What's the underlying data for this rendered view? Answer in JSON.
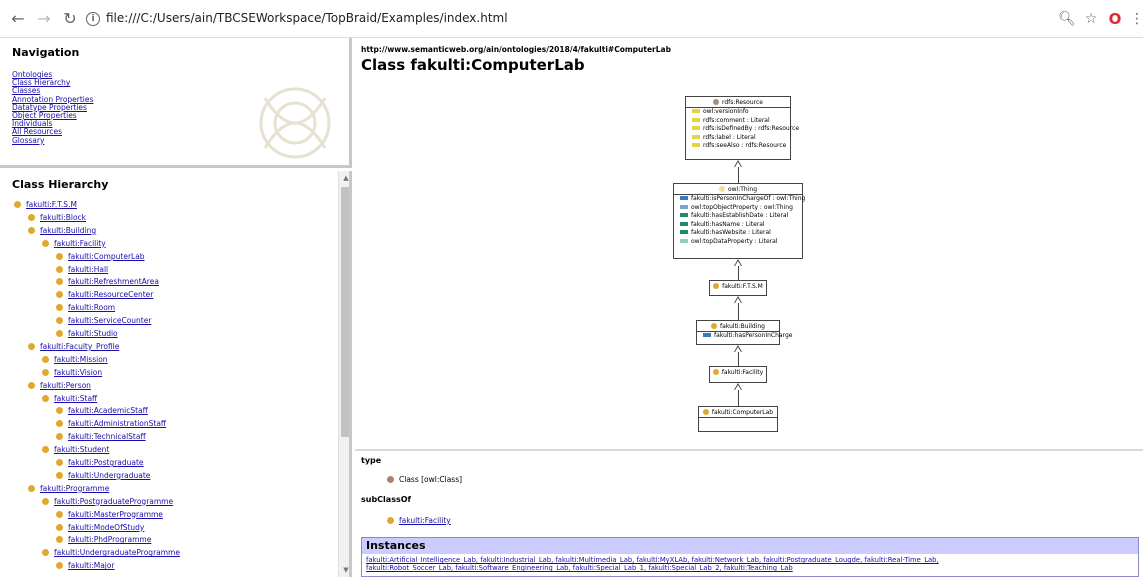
{
  "browser": {
    "url": "file:///C:/Users/ain/TBCSEWorkspace/TopBraid/Examples/index.html",
    "back_icon": "arrow-left",
    "forward_icon": "arrow-right",
    "reload_icon": "reload",
    "info_icon": "info",
    "zoom_icon": "magnifier",
    "bookmark_icon": "star",
    "opera_icon": "opera-logo",
    "menu_icon": "kebab-menu"
  },
  "navigation": {
    "heading": "Navigation",
    "links": [
      "Ontologies",
      "Class Hierarchy",
      "Classes",
      "Annotation Properties",
      "Datatype Properties",
      "Object Properties",
      "Individuals",
      "All Resources",
      "Glossary"
    ]
  },
  "class_hierarchy": {
    "heading": "Class Hierarchy",
    "items": [
      {
        "label": "fakulti:F.T.S.M",
        "depth": 0
      },
      {
        "label": "fakulti:Block",
        "depth": 1
      },
      {
        "label": "fakulti:Building",
        "depth": 1
      },
      {
        "label": "fakulti:Facility",
        "depth": 2
      },
      {
        "label": "fakulti:ComputerLab",
        "depth": 3
      },
      {
        "label": "fakulti:Hall",
        "depth": 3
      },
      {
        "label": "fakulti:RefreshmentArea",
        "depth": 3
      },
      {
        "label": "fakulti:ResourceCenter",
        "depth": 3
      },
      {
        "label": "fakulti:Room",
        "depth": 3
      },
      {
        "label": "fakulti:ServiceCounter",
        "depth": 3
      },
      {
        "label": "fakulti:Studio",
        "depth": 3
      },
      {
        "label": "fakulti:Faculty_Profile",
        "depth": 1
      },
      {
        "label": "fakulti:Mission",
        "depth": 2
      },
      {
        "label": "fakulti:Vision",
        "depth": 2
      },
      {
        "label": "fakulti:Person",
        "depth": 1
      },
      {
        "label": "fakulti:Staff",
        "depth": 2
      },
      {
        "label": "fakulti:AcademicStaff",
        "depth": 3
      },
      {
        "label": "fakulti:AdministrationStaff",
        "depth": 3
      },
      {
        "label": "fakulti:TechnicalStaff",
        "depth": 3
      },
      {
        "label": "fakulti:Student",
        "depth": 2
      },
      {
        "label": "fakulti:Postgraduate",
        "depth": 3
      },
      {
        "label": "fakulti:Undergraduate",
        "depth": 3
      },
      {
        "label": "fakulti:Programme",
        "depth": 1
      },
      {
        "label": "fakulti:PostgraduateProgramme",
        "depth": 2
      },
      {
        "label": "fakulti:MasterProgramme",
        "depth": 3
      },
      {
        "label": "fakulti:ModeOfStudy",
        "depth": 3
      },
      {
        "label": "fakulti:PhdProgramme",
        "depth": 3
      },
      {
        "label": "fakulti:UndergraduateProgramme",
        "depth": 2
      },
      {
        "label": "fakulti:Major",
        "depth": 3
      }
    ]
  },
  "main": {
    "uri": "http://www.semanticweb.org/ain/ontologies/2018/4/fakulti#ComputerLab",
    "title": "Class fakulti:ComputerLab",
    "diagram": {
      "rdfs_resource": {
        "title": "rdfs:Resource",
        "props": [
          "owl:versionInfo",
          "rdfs:comment : Literal",
          "rdfs:isDefinedBy : rdfs:Resource",
          "rdfs:label : Literal",
          "rdfs:seeAlso : rdfs:Resource"
        ]
      },
      "owl_thing": {
        "title": "owl:Thing",
        "props": [
          "fakulti:isPersonInChargeOf : owl:Thing",
          "owl:topObjectProperty : owl:Thing",
          "fakulti:hasEstablishDate : Literal",
          "fakulti:hasName : Literal",
          "fakulti:hasWebsite : Literal",
          "owl:topDataProperty : Literal"
        ],
        "prop_colors": [
          "#3a7bbf",
          "#6fa8dc",
          "#1f8a6b",
          "#1f8a6b",
          "#1f8a6b",
          "#8fd0b8"
        ]
      },
      "ftsm": {
        "title": "fakulti:F.T.S.M"
      },
      "building": {
        "title": "fakulti:Building",
        "props": [
          "fakulti:hasPersonInCharge"
        ]
      },
      "facility": {
        "title": "fakulti:Facility"
      },
      "computer_lab": {
        "title": "fakulti:ComputerLab"
      }
    },
    "type": {
      "label": "type",
      "value": "Class [owl:Class]"
    },
    "subclass_of": {
      "label": "subClassOf",
      "value": "fakulti:Facility"
    },
    "instances": {
      "heading": "Instances",
      "line1": "fakulti:Artificial_Intelligence_Lab, fakulti:Industrial_Lab, fakulti:Multimedia_Lab, fakulti:MyXLAb, fakulti:Network_Lab, fakulti:Postgraduate_Lougde, fakulti:Real-Time_Lab,",
      "line2": "fakulti:Robot_Soccer_Lab, fakulti:Software_Engineering_Lab, fakulti:Special_Lab_1, fakulti:Special_Lab_2, fakulti:Teaching_Lab"
    }
  },
  "colors": {
    "class_bullet": "#e0a82e",
    "type_bullet": "#b08070",
    "annotation_prop": "#e6d53a",
    "instances_header": "#ccccff",
    "link": "#1a0dab"
  }
}
